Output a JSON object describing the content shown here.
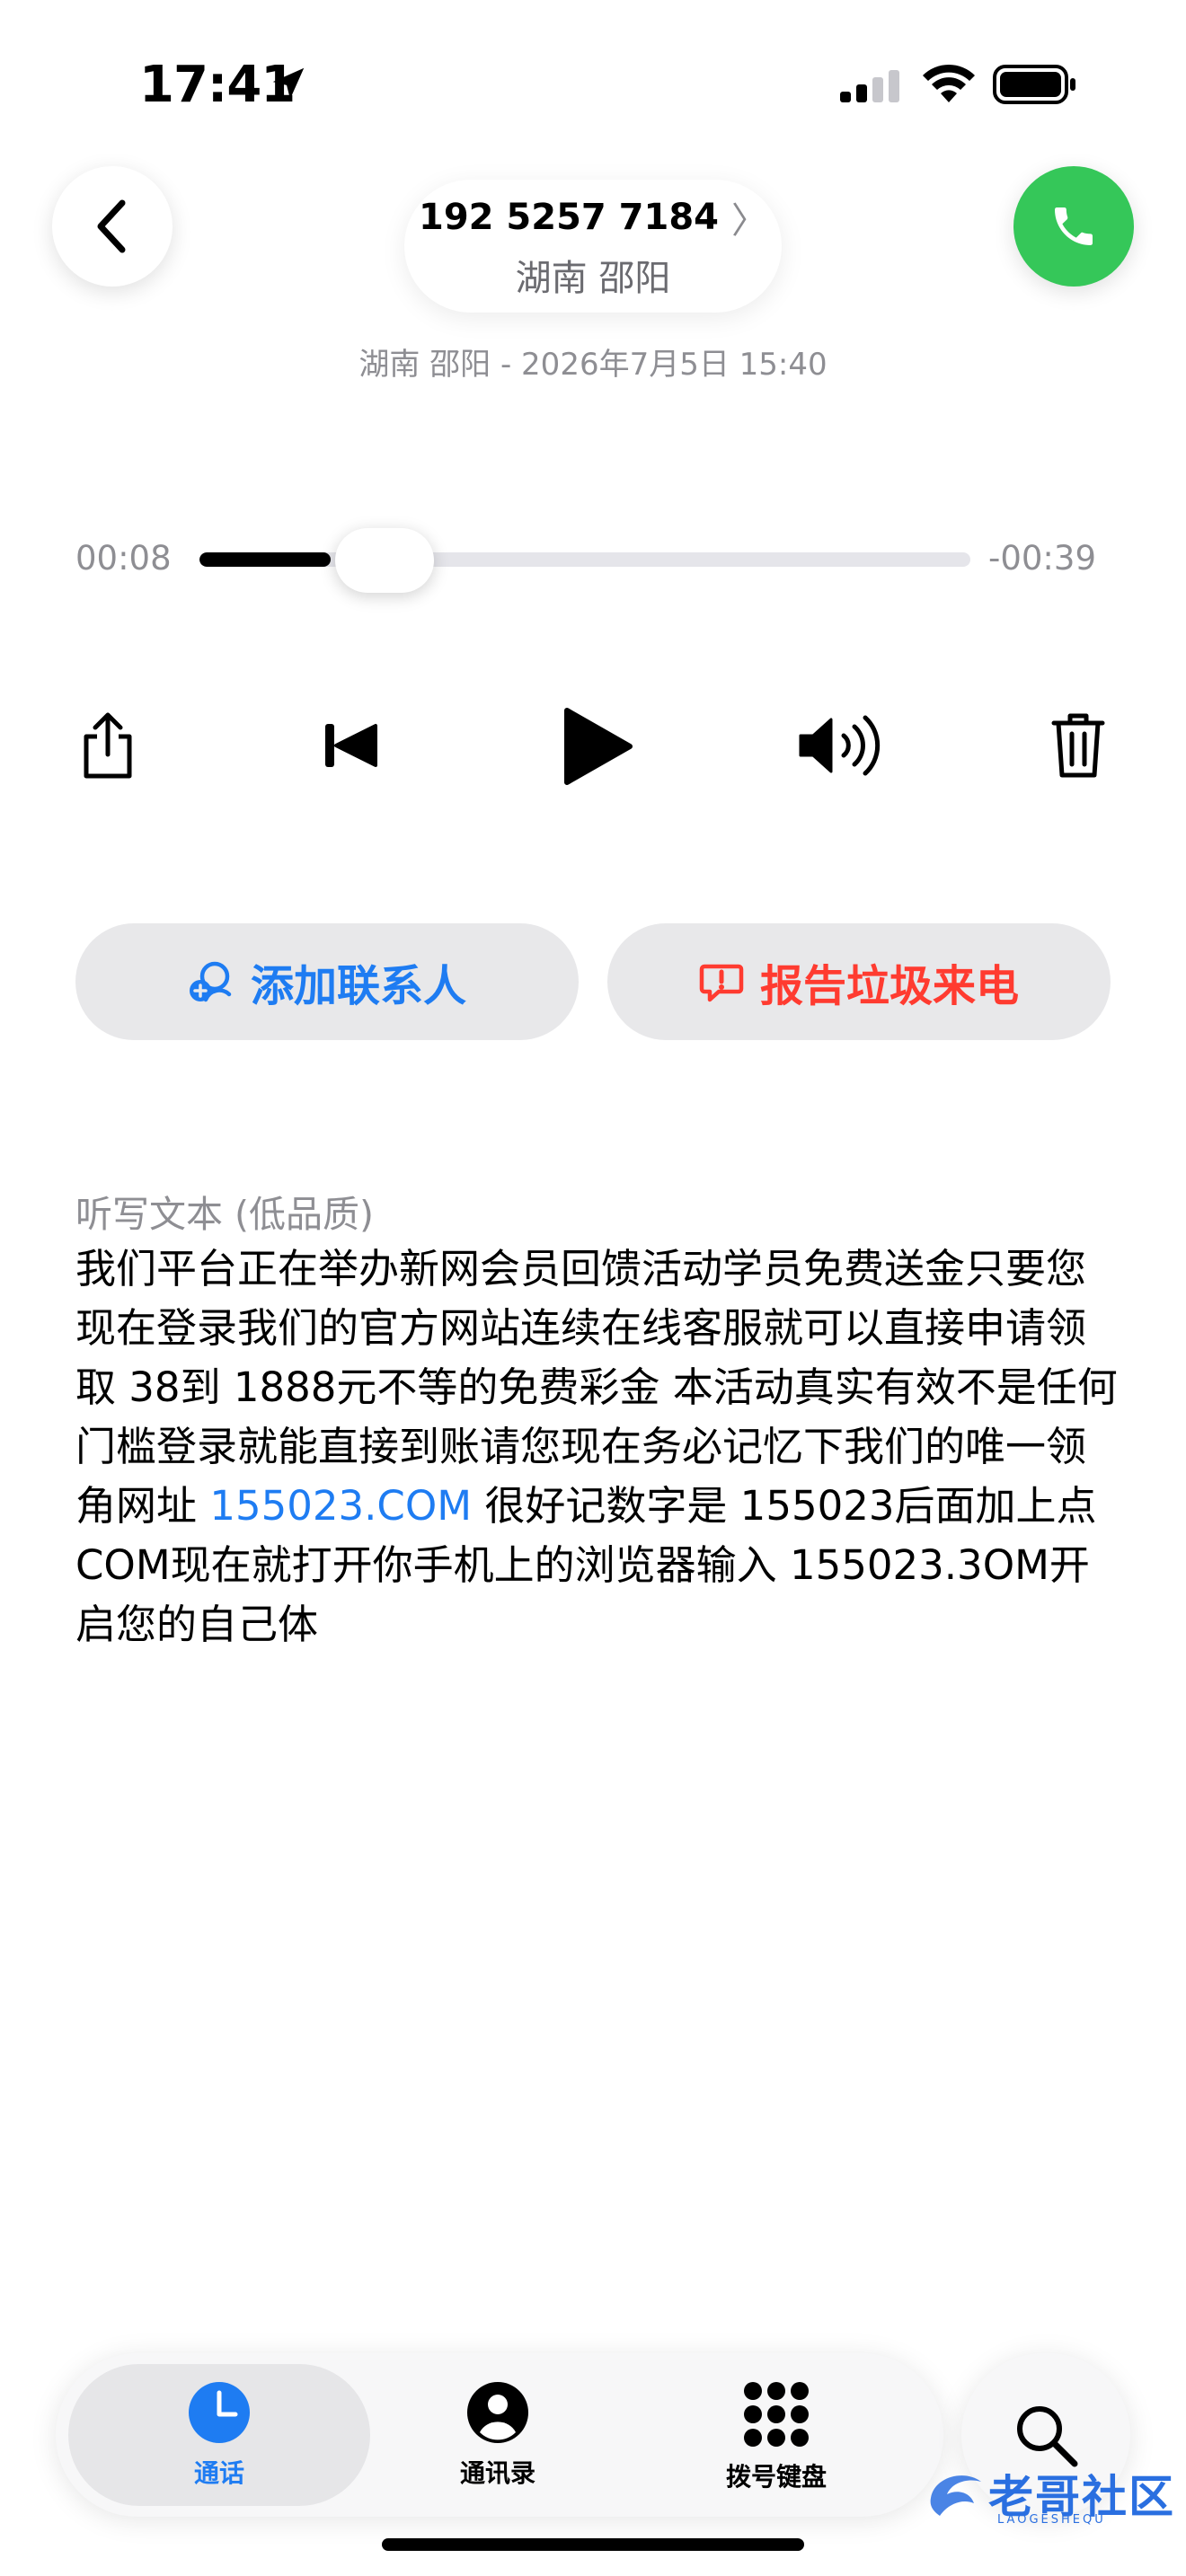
{
  "status_bar": {
    "time": "17:41"
  },
  "header": {
    "phone_number": "192 5257 7184",
    "chevron": "〉",
    "region": "湖南 邵阳",
    "subtitle": "湖南 邵阳 - 2026年7月5日 15:40"
  },
  "player": {
    "elapsed": "00:08",
    "remaining": "-00:39",
    "progress": 0.17
  },
  "controls": {
    "icons": [
      "share-icon",
      "skip-back-icon",
      "play-icon",
      "speaker-icon",
      "trash-icon"
    ]
  },
  "actions": {
    "add_contact": "添加联系人",
    "report_spam": "报告垃圾来电"
  },
  "transcript": {
    "label": "听写文本 (低品质)",
    "text_before_link": "我们平台正在举办新网会员回馈活动学员免费送金只要您现在登录我们的官方网站连续在线客服就可以直接申请领取 38到 1888元不等的免费彩金 本活动真实有效不是任何门槛登录就能直接到账请您现在务必记忆下我们的唯一领角网址 ",
    "link_text": "155023.COM",
    "text_after_link": " 很好记数字是 155023后面加上点 COM现在就打开你手机上的浏览器输入 155023.3OM开启您的自己体"
  },
  "tabbar": {
    "calls": "通话",
    "contacts": "通讯录",
    "keypad": "拨号键盘"
  },
  "watermark": {
    "text": "老哥社区",
    "sub": "LAOGESHEQU"
  },
  "colors": {
    "accent_blue": "#1e7cf2",
    "call_green": "#35c759",
    "spam_red": "#ff3b30",
    "secondary_text": "#8e8e93"
  }
}
